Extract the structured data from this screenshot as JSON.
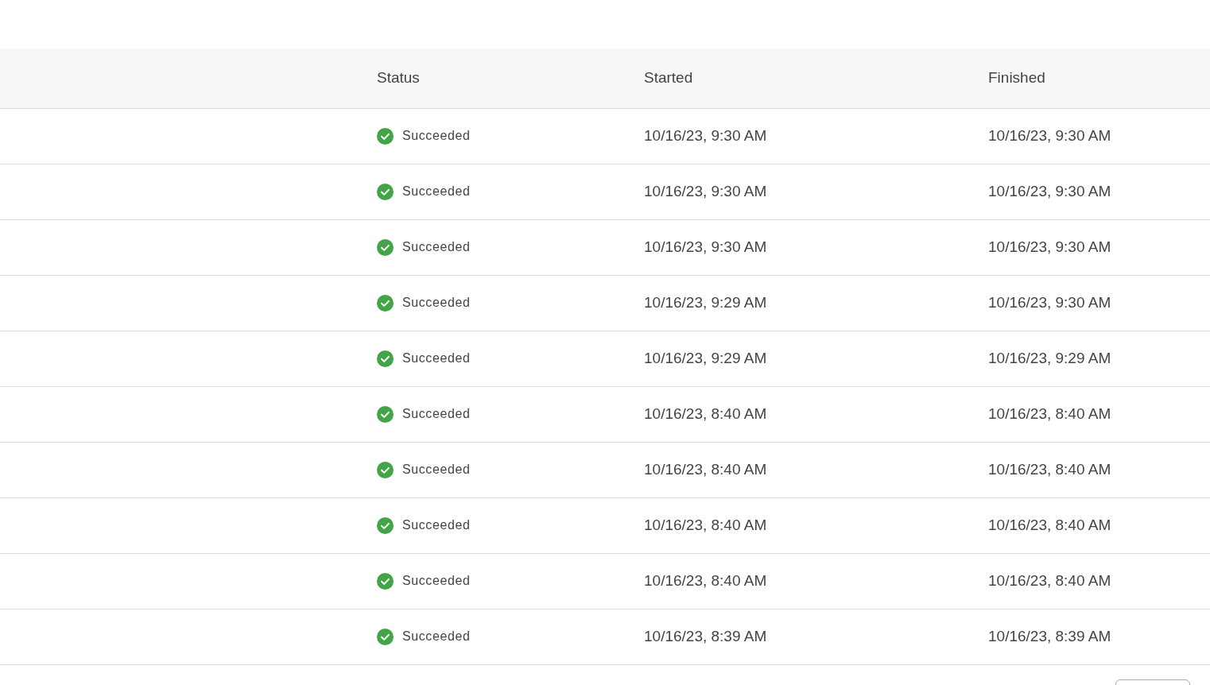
{
  "table": {
    "columns": [
      "Status",
      "Started",
      "Finished"
    ],
    "rows": [
      {
        "status": {
          "kind": "succeeded",
          "label": "Succeeded"
        },
        "started": "10/16/23, 9:30 AM",
        "finished": "10/16/23, 9:30 AM"
      },
      {
        "status": {
          "kind": "succeeded",
          "label": "Succeeded"
        },
        "started": "10/16/23, 9:30 AM",
        "finished": "10/16/23, 9:30 AM"
      },
      {
        "status": {
          "kind": "succeeded",
          "label": "Succeeded"
        },
        "started": "10/16/23, 9:30 AM",
        "finished": "10/16/23, 9:30 AM"
      },
      {
        "status": {
          "kind": "succeeded",
          "label": "Succeeded"
        },
        "started": "10/16/23, 9:29 AM",
        "finished": "10/16/23, 9:30 AM"
      },
      {
        "status": {
          "kind": "succeeded",
          "label": "Succeeded"
        },
        "started": "10/16/23, 9:29 AM",
        "finished": "10/16/23, 9:29 AM"
      },
      {
        "status": {
          "kind": "succeeded",
          "label": "Succeeded"
        },
        "started": "10/16/23, 8:40 AM",
        "finished": "10/16/23, 8:40 AM"
      },
      {
        "status": {
          "kind": "succeeded",
          "label": "Succeeded"
        },
        "started": "10/16/23, 8:40 AM",
        "finished": "10/16/23, 8:40 AM"
      },
      {
        "status": {
          "kind": "succeeded",
          "label": "Succeeded"
        },
        "started": "10/16/23, 8:40 AM",
        "finished": "10/16/23, 8:40 AM"
      },
      {
        "status": {
          "kind": "succeeded",
          "label": "Succeeded"
        },
        "started": "10/16/23, 8:40 AM",
        "finished": "10/16/23, 8:40 AM"
      },
      {
        "status": {
          "kind": "succeeded",
          "label": "Succeeded"
        },
        "started": "10/16/23, 8:39 AM",
        "finished": "10/16/23, 8:39 AM"
      }
    ]
  }
}
